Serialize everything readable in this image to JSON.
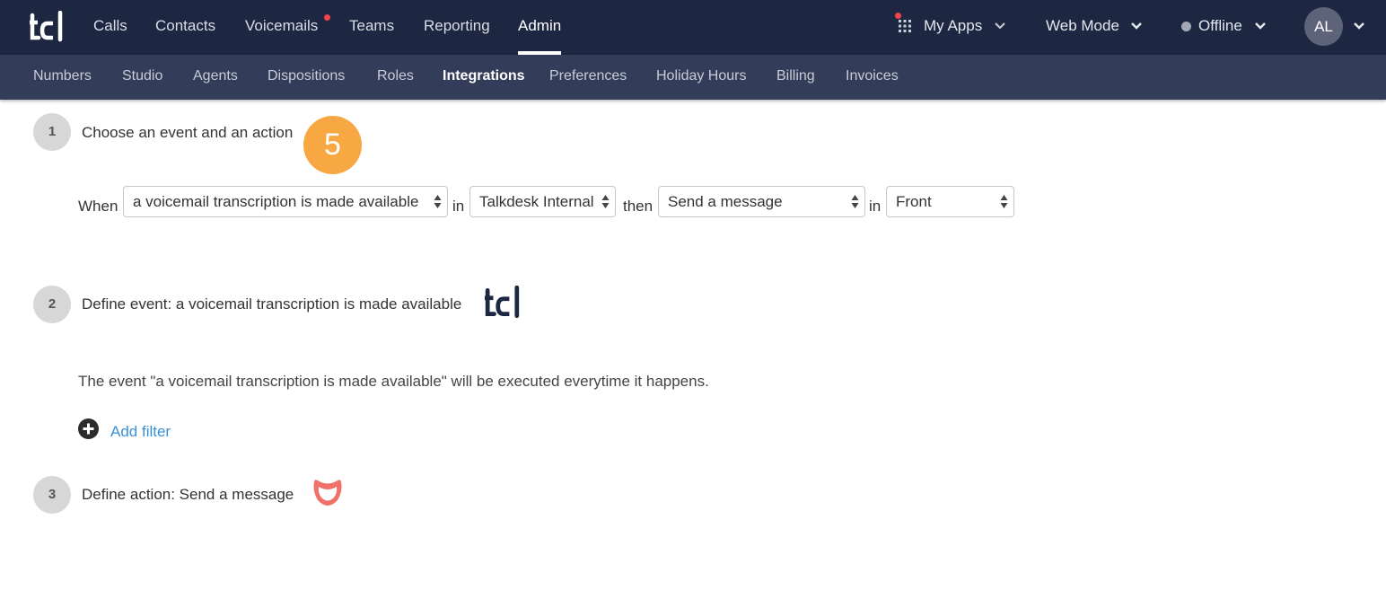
{
  "topbar": {
    "logo": "td-logo",
    "nav": [
      "Calls",
      "Contacts",
      "Voicemails",
      "Teams",
      "Reporting",
      "Admin"
    ],
    "active_nav": "Admin",
    "my_apps": "My Apps",
    "web_mode": "Web Mode",
    "status": "Offline",
    "avatar_initials": "AL",
    "colors": {
      "background": "#1e2741",
      "notification_dot": "#f0454b"
    }
  },
  "subnav": {
    "items": [
      "Numbers",
      "Studio",
      "Agents",
      "Dispositions",
      "Roles",
      "Integrations",
      "Preferences",
      "Holiday Hours",
      "Billing",
      "Invoices"
    ],
    "active": "Integrations"
  },
  "step1": {
    "number": "1",
    "title": "Choose an event and an action",
    "badge": "5",
    "when_label": "When",
    "event_select": "a voicemail transcription is made available",
    "in_label_1": "in",
    "source_select": "Talkdesk Internal",
    "then_label": "then",
    "action_select": "Send a message",
    "in_label_2": "in",
    "target_select": "Front"
  },
  "step2": {
    "number": "2",
    "title": "Define event: a voicemail transcription is made available",
    "description": "The event \"a voicemail transcription is made available\" will be executed everytime it happens.",
    "add_filter": "Add filter"
  },
  "step3": {
    "number": "3",
    "title": "Define action: Send a message",
    "icon": "front-icon"
  },
  "colors": {
    "accent_badge": "#f7a842",
    "link": "#3b8fd6",
    "front_brand": "#f0706a"
  }
}
